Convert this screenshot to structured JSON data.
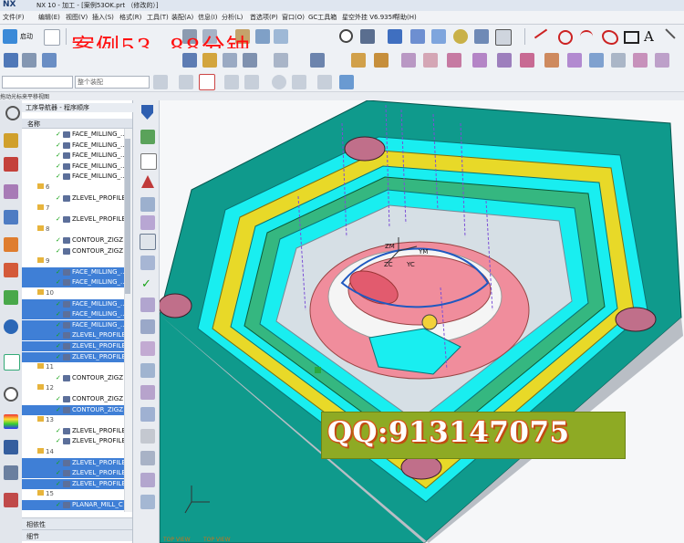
{
  "window": {
    "logo": "NX",
    "title": "NX 10 - 加工 - [案例53OK.prt （修改的）]"
  },
  "menu": [
    "文件(F)",
    "编辑(E)",
    "视图(V)",
    "插入(S)",
    "格式(R)",
    "工具(T)",
    "装配(A)",
    "信息(I)",
    "分析(L)",
    "首选项(P)",
    "窗口(O)",
    "GC工具箱",
    "星空外挂 V6.935F",
    "帮助(H)"
  ],
  "toolbar": {
    "start_label": "启动",
    "filter_placeholder": "整个装配"
  },
  "overlay_title": "案例53  88分钟",
  "status_text": "拖动光标来平移视图",
  "navigator": {
    "title": "工序导航器 - 程序顺序",
    "column": "名称",
    "rows": [
      {
        "type": "op",
        "label": "FACE_MILLING_...",
        "sel": false
      },
      {
        "type": "op",
        "label": "FACE_MILLING_...",
        "sel": false
      },
      {
        "type": "op",
        "label": "FACE_MILLING_...",
        "sel": false
      },
      {
        "type": "op",
        "label": "FACE_MILLING_...",
        "sel": false
      },
      {
        "type": "op",
        "label": "FACE_MILLING_...",
        "sel": false
      },
      {
        "type": "grp",
        "label": "6"
      },
      {
        "type": "op",
        "label": "ZLEVEL_PROFILE",
        "sel": false
      },
      {
        "type": "grp",
        "label": "7"
      },
      {
        "type": "op",
        "label": "ZLEVEL_PROFILE",
        "sel": false
      },
      {
        "type": "grp",
        "label": "8"
      },
      {
        "type": "op",
        "label": "CONTOUR_ZIGZ",
        "sel": false
      },
      {
        "type": "op",
        "label": "CONTOUR_ZIGZ",
        "sel": false
      },
      {
        "type": "grp",
        "label": "9"
      },
      {
        "type": "op",
        "label": "FACE_MILLING_...",
        "sel": true
      },
      {
        "type": "op",
        "label": "FACE_MILLING_...",
        "sel": true
      },
      {
        "type": "grp",
        "label": "10"
      },
      {
        "type": "op",
        "label": "FACE_MILLING_...",
        "sel": true
      },
      {
        "type": "op",
        "label": "FACE_MILLING_...",
        "sel": true
      },
      {
        "type": "op",
        "label": "FACE_MILLING_...",
        "sel": true
      },
      {
        "type": "op",
        "label": "ZLEVEL_PROFILE",
        "sel": true
      },
      {
        "type": "op",
        "label": "ZLEVEL_PROFILE",
        "sel": true
      },
      {
        "type": "op",
        "label": "ZLEVEL_PROFILE",
        "sel": true
      },
      {
        "type": "grp",
        "label": "11"
      },
      {
        "type": "op",
        "label": "CONTOUR_ZIGZ",
        "sel": false
      },
      {
        "type": "grp",
        "label": "12"
      },
      {
        "type": "op",
        "label": "CONTOUR_ZIGZ",
        "sel": false
      },
      {
        "type": "op",
        "label": "CONTOUR_ZIGZ",
        "sel": true
      },
      {
        "type": "grp",
        "label": "13"
      },
      {
        "type": "op",
        "label": "ZLEVEL_PROFILE",
        "sel": false
      },
      {
        "type": "op",
        "label": "ZLEVEL_PROFILE",
        "sel": false
      },
      {
        "type": "grp",
        "label": "14"
      },
      {
        "type": "op",
        "label": "ZLEVEL_PROFILE",
        "sel": true
      },
      {
        "type": "op",
        "label": "ZLEVEL_PROFILE",
        "sel": true
      },
      {
        "type": "op",
        "label": "ZLEVEL_PROFILE",
        "sel": true
      },
      {
        "type": "grp",
        "label": "15"
      },
      {
        "type": "op",
        "label": "PLANAR_MILL_C",
        "sel": true
      }
    ],
    "dependencies_label": "相依性",
    "details_label": "细节"
  },
  "graphics": {
    "watermark": "QQ:913147075",
    "triad_labels": [
      "ZM",
      "YM",
      "ZC",
      "YC"
    ],
    "view_labels": [
      "TOP VIEW",
      "TOP VIEW"
    ]
  },
  "colors": {
    "base": "#0f9a8c",
    "cyan": "#19eef0",
    "yellow": "#e8d928",
    "pink": "#f08d9c",
    "watermark_bg": "#8eaa24"
  }
}
